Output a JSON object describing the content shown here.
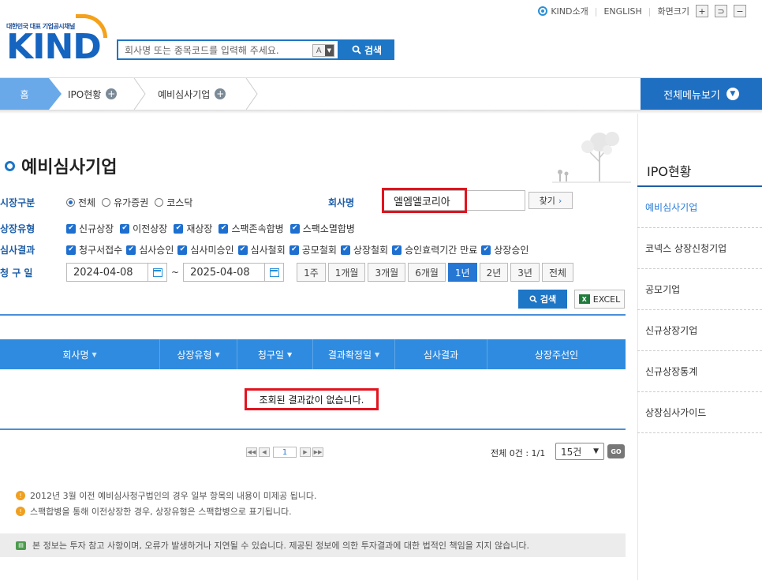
{
  "util": {
    "kind_intro": "KIND소개",
    "english": "ENGLISH",
    "screen_size": "화면크기",
    "zoom_in": "+",
    "zoom_reset": "⊃",
    "zoom_out": "−"
  },
  "logo": {
    "tagline": "대한민국 대표 기업공시채널",
    "brand": "KIND"
  },
  "search": {
    "placeholder": "회사명 또는 종목코드를 입력해 주세요.",
    "type": "A",
    "button": "검색"
  },
  "nav": {
    "home": "홈",
    "crumbs": [
      "IPO현황",
      "예비심사기업"
    ],
    "all_menu": "전체메뉴보기"
  },
  "page": {
    "title": "예비심사기업"
  },
  "filters": {
    "market": {
      "label": "시장구분",
      "options": [
        "전체",
        "유가증권",
        "코스닥"
      ],
      "selected": "전체"
    },
    "listing_type": {
      "label": "상장유형",
      "options": [
        "신규상장",
        "이전상장",
        "재상장",
        "스팩존속합병",
        "스팩소멸합병"
      ]
    },
    "result": {
      "label": "심사결과",
      "options": [
        "청구서접수",
        "심사승인",
        "심사미승인",
        "심사철회",
        "공모철회",
        "상장철회",
        "승인효력기간 만료",
        "상장승인"
      ]
    },
    "company": {
      "label": "회사명",
      "value": "엘엠엘코리아",
      "find_button": "찾기"
    },
    "date": {
      "label": "청 구 일",
      "from": "2024-04-08",
      "to": "2025-04-08",
      "separator": "~",
      "periods": [
        "1주",
        "1개월",
        "3개월",
        "6개월",
        "1년",
        "2년",
        "3년",
        "전체"
      ],
      "selected_period": "1년"
    },
    "search_button": "검색",
    "excel_button": "EXCEL"
  },
  "table": {
    "columns": [
      {
        "label": "회사명",
        "sort": "▼"
      },
      {
        "label": "상장유형",
        "sort": "▼"
      },
      {
        "label": "청구일",
        "sort": "▼"
      },
      {
        "label": "결과확정일",
        "sort": "▼"
      },
      {
        "label": "심사결과",
        "sort": ""
      },
      {
        "label": "상장주선인",
        "sort": ""
      }
    ],
    "empty_message": "조회된 결과값이 없습니다."
  },
  "pagination": {
    "current_page": "1",
    "total": "전체 0건 : 1/1",
    "page_size": "15건",
    "go": "GO"
  },
  "notes": [
    "2012년 3월 이전 예비심사청구법인의 경우 일부 항목의 내용이 미제공 됩니다.",
    "스팩합병을 통해 이전상장한 경우, 상장유형은 스팩합병으로 표기됩니다."
  ],
  "disclaimer": "본 정보는 투자 참고 사항이며, 오류가 발생하거나 지연될 수 있습니다. 제공된 정보에 의한 투자결과에 대한 법적인 책임을 지지 않습니다.",
  "sidebar": {
    "title": "IPO현황",
    "items": [
      "예비심사기업",
      "코넥스 상장신청기업",
      "공모기업",
      "신규상장기업",
      "신규상장통계",
      "상장심사가이드"
    ],
    "active": "예비심사기업"
  },
  "colors": {
    "brand_blue": "#1d76c6",
    "header_blue": "#2f8be0",
    "highlight_red": "#e2131f",
    "logo_orange": "#f4a11b"
  }
}
